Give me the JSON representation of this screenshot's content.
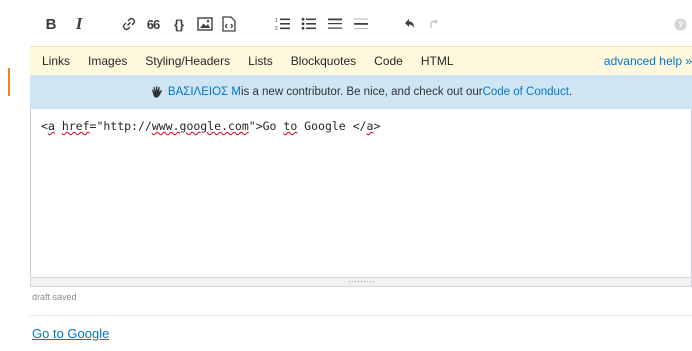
{
  "toolbar": {
    "bold": "B",
    "italic": "I",
    "quote": "66",
    "code": "{}",
    "icons": [
      "bold-icon",
      "italic-icon",
      "link-icon",
      "blockquote-icon",
      "code-sample-icon",
      "image-icon",
      "snippet-icon",
      "numbered-list-icon",
      "bulleted-list-icon",
      "heading-icon",
      "horizontal-rule-icon",
      "undo-icon",
      "redo-icon",
      "help-icon"
    ]
  },
  "help_bar": {
    "links": [
      "Links",
      "Images",
      "Styling/Headers",
      "Lists",
      "Blockquotes",
      "Code",
      "HTML"
    ],
    "advanced": "advanced help »"
  },
  "notice": {
    "username": "ΒΑΣΙΛΕΙΟΣ Μ",
    "text": " is a new contributor. Be nice, and check out our ",
    "link": "Code of Conduct",
    "end": "."
  },
  "editor": {
    "code_segments": [
      "<",
      "a",
      " ",
      "href",
      "=\"http://",
      "www.google.com",
      "\">Go ",
      "to",
      " Google </",
      "a",
      ">"
    ]
  },
  "status": {
    "draft": "draft saved"
  },
  "preview": {
    "link_text": "Go to Google"
  },
  "colors": {
    "help_bar_bg": "#fff8dc",
    "notice_bg": "#cfe5f4",
    "link": "#0077cc",
    "accent": "#f48024"
  }
}
